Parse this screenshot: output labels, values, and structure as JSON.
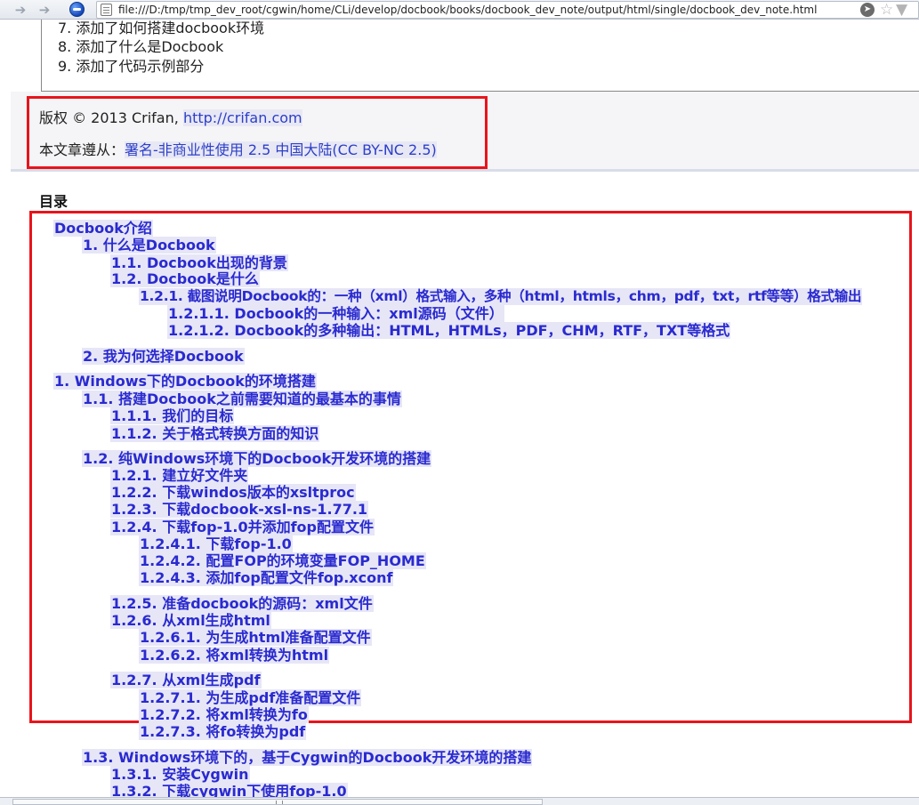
{
  "browser": {
    "url": "file:///D:/tmp/tmp_dev_root/cgwin/home/CLi/develop/docbook/books/docbook_dev_note/output/html/single/docbook_dev_note.html",
    "icons": [
      "back-arrow-icon",
      "forward-arrow-icon",
      "globe-icon",
      "page-icon",
      "go-icon",
      "star-icon"
    ]
  },
  "revision": {
    "items": [
      "7. 添加了如何搭建docbook环境",
      "8. 添加了什么是Docbook",
      "9. 添加了代码示例部分"
    ]
  },
  "copyright": {
    "prefix": "版权 © 2013 Crifan, ",
    "link": "http://crifan.com",
    "license_prefix": "本文章遵从：",
    "license_link": "署名-非商业性使用 2.5 中国大陆(CC BY-NC 2.5)"
  },
  "toc": {
    "title": "目录",
    "entries": [
      "Docbook介绍",
      "1. 什么是Docbook",
      "1.1. Docbook出现的背景",
      "1.2. Docbook是什么",
      "1.2.1. 截图说明Docbook的：一种（xml）格式输入，多种（html，htmls，chm，pdf，txt，rtf等等）格式输出",
      "1.2.1.1. Docbook的一种输入：xml源码（文件）",
      "1.2.1.2. Docbook的多种输出：HTML，HTMLs，PDF，CHM，RTF，TXT等格式",
      "2. 我为何选择Docbook",
      "1. Windows下的Docbook的环境搭建",
      "1.1. 搭建Docbook之前需要知道的最基本的事情",
      "1.1.1. 我们的目标",
      "1.1.2. 关于格式转换方面的知识",
      "1.2. 纯Windows环境下的Docbook开发环境的搭建",
      "1.2.1. 建立好文件夹",
      "1.2.2. 下载windos版本的xsltproc",
      "1.2.3. 下载docbook-xsl-ns-1.77.1",
      "1.2.4. 下载fop-1.0并添加fop配置文件",
      "1.2.4.1. 下载fop-1.0",
      "1.2.4.2. 配置FOP的环境变量FOP_HOME",
      "1.2.4.3. 添加fop配置文件fop.xconf",
      "1.2.5. 准备docbook的源码：xml文件",
      "1.2.6. 从xml生成html",
      "1.2.6.1. 为生成html准备配置文件",
      "1.2.6.2. 将xml转换为html",
      "1.2.7. 从xml生成pdf",
      "1.2.7.1. 为生成pdf准备配置文件",
      "1.2.7.2. 将xml转换为fo",
      "1.2.7.3. 将fo转换为pdf",
      "1.3. Windows环境下的，基于Cygwin的Docbook开发环境的搭建",
      "1.3.1. 安装Cygwin",
      "1.3.2. 下载cygwin下使用fop-1.0"
    ]
  }
}
